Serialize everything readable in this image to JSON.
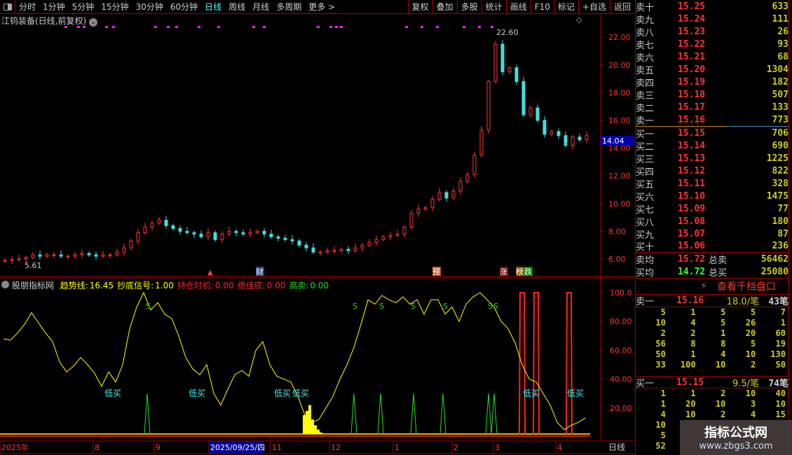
{
  "topbar": {
    "periods": [
      "分时",
      "1分钟",
      "5分钟",
      "15分钟",
      "30分钟",
      "60分钟",
      "日线",
      "周线",
      "月线",
      "多周期",
      "更多 >"
    ],
    "active": "日线",
    "tools": [
      "复权",
      "叠加",
      "多股",
      "统计",
      "画线",
      "F10",
      "标记",
      "+自选",
      "返回"
    ]
  },
  "chart": {
    "title": "江钨装备(日线,前复权)",
    "high_label": "22.60",
    "low_label": "5.61",
    "current_price": "14.04",
    "price_ticks": [
      "22.00",
      "20.00",
      "18.00",
      "16.00",
      "14.00",
      "12.00",
      "10.00",
      "8.00",
      "6.00"
    ],
    "markers": [
      "财",
      "预",
      "涨",
      "榜",
      "跌"
    ],
    "closes": [
      5.9,
      5.95,
      6.0,
      6.1,
      6.3,
      6.2,
      6.3,
      6.3,
      6.2,
      6.2,
      6.3,
      6.4,
      6.3,
      6.2,
      6.3,
      6.3,
      6.5,
      6.8,
      7.3,
      7.9,
      8.3,
      8.6,
      8.8,
      8.4,
      8.2,
      8.0,
      7.9,
      7.8,
      7.6,
      7.9,
      7.4,
      7.8,
      8.0,
      7.9,
      7.8,
      7.9,
      8.0,
      7.8,
      7.6,
      7.5,
      7.4,
      7.3,
      7.0,
      6.8,
      6.5,
      6.5,
      6.6,
      6.6,
      6.7,
      6.6,
      6.8,
      7.0,
      7.2,
      7.4,
      7.6,
      7.7,
      7.8,
      8.3,
      9.3,
      9.6,
      9.7,
      10.3,
      10.8,
      10.4,
      10.9,
      11.6,
      12.1,
      13.5,
      15.3,
      18.8,
      21.5,
      19.5,
      19.8,
      18.8,
      16.4,
      16.9,
      16.0,
      15.0,
      15.2,
      14.9,
      14.2,
      14.8,
      14.6,
      14.9
    ],
    "up_color": "#ff3333",
    "down_color": "#44dddd"
  },
  "indicator": {
    "name": "股朋指标网",
    "values": [
      {
        "label": "趋势线:",
        "value": "16.45",
        "color": "#ffff00"
      },
      {
        "label": "抄底信号:",
        "value": "1.00",
        "color": "#ffff00"
      },
      {
        "label": "持仓时机:",
        "value": "0.00",
        "color": "#ff2222"
      },
      {
        "label": "绝佳底:",
        "value": "0.00",
        "color": "#ff2222"
      },
      {
        "label": "高卖:",
        "value": "0.00",
        "color": "#22dd22"
      }
    ],
    "ticks": [
      "100.0",
      "80.00",
      "60.00",
      "40.00",
      "20.00"
    ],
    "trend": [
      68,
      67,
      72,
      78,
      86,
      79,
      72,
      66,
      52,
      45,
      49,
      55,
      50,
      44,
      35,
      45,
      38,
      50,
      75,
      90,
      100,
      88,
      93,
      85,
      82,
      70,
      55,
      47,
      43,
      50,
      30,
      22,
      33,
      43,
      46,
      42,
      60,
      66,
      50,
      42,
      40,
      38,
      28,
      15,
      10,
      12,
      20,
      28,
      40,
      50,
      62,
      78,
      95,
      92,
      98,
      95,
      93,
      97,
      92,
      95,
      85,
      95,
      95,
      85,
      90,
      80,
      92,
      97,
      100,
      95,
      90,
      80,
      75,
      65,
      50,
      40,
      38,
      30,
      22,
      10,
      5,
      8,
      10,
      13
    ],
    "buy_label": "低买",
    "sell_label": "S"
  },
  "timeline": {
    "labels": [
      "2025年",
      "8",
      "9",
      "2025/09/25/四",
      "11",
      "12",
      "1",
      "2",
      "3",
      "4"
    ],
    "period": "日线"
  },
  "book": {
    "asks": [
      [
        "卖十",
        "15.25",
        "633"
      ],
      [
        "卖九",
        "15.24",
        "111"
      ],
      [
        "卖八",
        "15.23",
        "26"
      ],
      [
        "卖七",
        "15.22",
        "93"
      ],
      [
        "卖六",
        "15.21",
        "68"
      ],
      [
        "卖五",
        "15.20",
        "1304"
      ],
      [
        "卖四",
        "15.19",
        "182"
      ],
      [
        "卖三",
        "15.18",
        "507"
      ],
      [
        "卖二",
        "15.17",
        "133"
      ],
      [
        "卖一",
        "15.16",
        "773"
      ]
    ],
    "bids": [
      [
        "买一",
        "15.15",
        "706"
      ],
      [
        "买二",
        "15.14",
        "690"
      ],
      [
        "买三",
        "15.13",
        "1225"
      ],
      [
        "买四",
        "15.12",
        "822"
      ],
      [
        "买五",
        "15.11",
        "328"
      ],
      [
        "买六",
        "15.10",
        "1475"
      ],
      [
        "买七",
        "15.09",
        "77"
      ],
      [
        "买八",
        "15.08",
        "180"
      ],
      [
        "买九",
        "15.07",
        "87"
      ],
      [
        "买十",
        "15.06",
        "236"
      ]
    ],
    "avg_sell": {
      "label": "卖均",
      "price": "15.72",
      "total_label": "总卖",
      "total": "56462"
    },
    "avg_buy": {
      "label": "买均",
      "price": "14.72",
      "total_label": "总买",
      "total": "25080"
    },
    "deep_link": "查看千档盘口",
    "sell1": {
      "label": "卖一",
      "price": "15.16",
      "avg": "18.0/笔",
      "count": "43笔",
      "orders": [
        "5",
        "1",
        "5",
        "5",
        "7",
        "10",
        "4",
        "5",
        "26",
        "1",
        "2",
        "2",
        "1",
        "20",
        "60",
        "56",
        "8",
        "8",
        "5",
        "19",
        "50",
        "1",
        "4",
        "10",
        "130",
        "33",
        "100",
        "10",
        "2",
        "50"
      ]
    },
    "buy1": {
      "label": "买一",
      "price": "15.15",
      "avg": "9.5/笔",
      "count": "74笔",
      "orders": [
        "1",
        "1",
        "2",
        "10",
        "40",
        "1",
        "20",
        "10",
        "3",
        "10",
        "4",
        "10",
        "2",
        "4",
        "15",
        "10",
        "",
        "",
        "",
        "",
        "5",
        "",
        "",
        "",
        "",
        "52",
        "",
        "",
        "",
        ""
      ]
    }
  },
  "watermark": {
    "title": "指标公式网",
    "url": "www.zbgs3.com"
  }
}
